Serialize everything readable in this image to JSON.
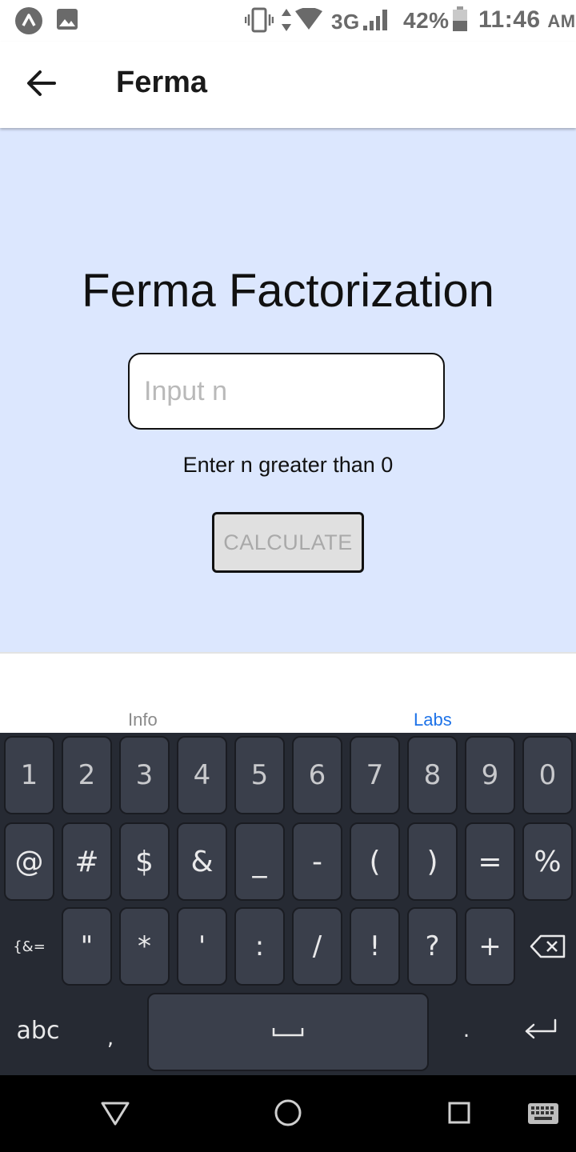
{
  "status_bar": {
    "network": "3G",
    "battery": "42%",
    "time": "11:46",
    "ampm": "AM",
    "icons": [
      "app-notification-icon",
      "image-notification-icon",
      "vibrate-icon",
      "data-arrows-icon",
      "wifi-icon",
      "cell-signal-icon",
      "battery-icon"
    ]
  },
  "app_bar": {
    "title": "Ferma",
    "back_icon": "arrow-left-icon"
  },
  "main": {
    "heading": "Ferma Factorization",
    "input_placeholder": "Input n",
    "input_value": "",
    "hint": "Enter n greater than 0",
    "button_label": "CALCULATE",
    "background": "#dce7fe"
  },
  "tabs": [
    {
      "label": "Info",
      "active": false
    },
    {
      "label": "Labs",
      "active": true
    }
  ],
  "tab_active_color": "#1e73e8",
  "keyboard": {
    "row1": [
      "1",
      "2",
      "3",
      "4",
      "5",
      "6",
      "7",
      "8",
      "9",
      "0"
    ],
    "row2": [
      "@",
      "#",
      "$",
      "&",
      "_",
      "-",
      "(",
      ")",
      "=",
      "%"
    ],
    "row3_left": "{&=",
    "row3": [
      "\"",
      "*",
      "'",
      ":",
      "/",
      "!",
      "?",
      "+"
    ],
    "row4_left": "abc",
    "row4_comma": ",",
    "row4_period": ".",
    "icons": [
      "backspace-icon",
      "space-bar-icon",
      "enter-icon"
    ]
  },
  "nav_bar": {
    "icons": [
      "nav-back-icon",
      "nav-home-icon",
      "nav-recents-icon",
      "keyboard-switch-icon"
    ]
  }
}
